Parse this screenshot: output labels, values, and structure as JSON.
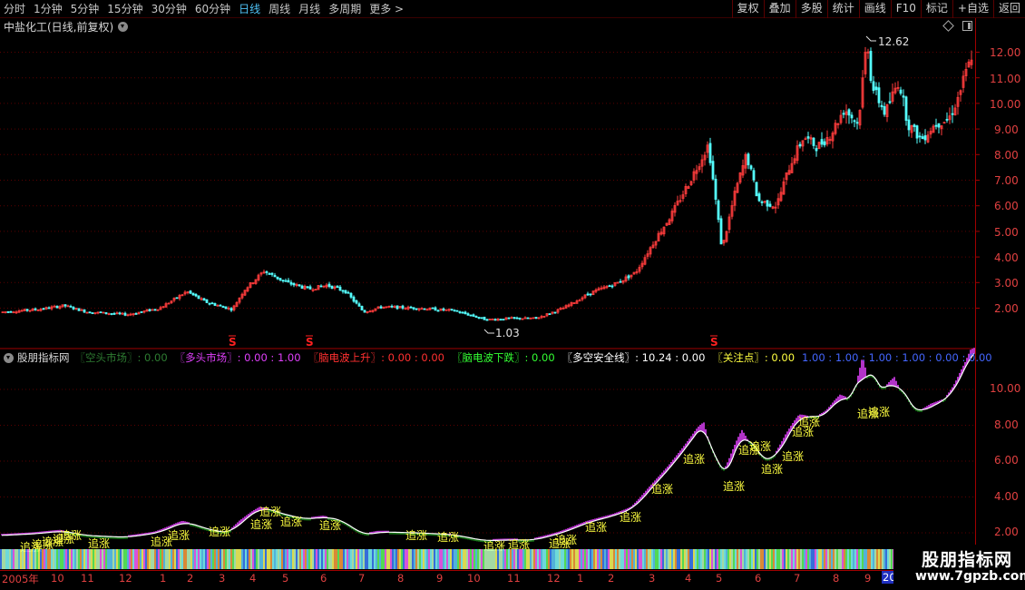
{
  "toolbar": {
    "period_tabs": [
      "分时",
      "1分钟",
      "5分钟",
      "15分钟",
      "30分钟",
      "60分钟",
      "日线",
      "周线",
      "月线",
      "多周期",
      "更多 >"
    ],
    "active_tab": "日线",
    "right_buttons": [
      "复权",
      "叠加",
      "多股",
      "统计",
      "画线",
      "F10",
      "标记",
      "+自选",
      "返回"
    ]
  },
  "main_chart": {
    "title": "中盐化工(日线,前复权)",
    "max_label": "12.62",
    "min_label": "1.03",
    "y_ticks": [
      "12.00",
      "11.00",
      "10.00",
      "9.00",
      "8.00",
      "7.00",
      "6.00",
      "5.00",
      "4.00",
      "3.00",
      "2.00"
    ],
    "markers": [
      "S",
      "S",
      "S"
    ]
  },
  "indicator": {
    "name": "股朋指标网",
    "items": [
      {
        "text": "〖空头市场〗: 0.00",
        "color": "#2e7d32"
      },
      {
        "text": "〖多头市场〗: 0.00 : 1.00",
        "color": "#e040fb"
      },
      {
        "text": "〖脑电波上升〗: 0.00 : 0.00",
        "color": "#ff3030"
      },
      {
        "text": "〖脑电波下跌〗: 0.00",
        "color": "#33ff33"
      },
      {
        "text": "〖多空安全线〗: 10.24 : 0.00",
        "color": "#ffffff"
      },
      {
        "text": "〖关注点〗: 0.00",
        "color": "#ffff40"
      },
      {
        "text": "1.00 : 1.00 : 1.00 : 1.00 : 0.00 : 0.00",
        "color": "#4466ff"
      }
    ],
    "y_ticks": [
      "10.00",
      "8.00",
      "6.00",
      "4.00",
      "2.00"
    ],
    "signal_label": "追涨"
  },
  "x_axis": {
    "labels": [
      "2005年",
      "10",
      "11",
      "12",
      "1",
      "2",
      "3",
      "4",
      "5",
      "6",
      "7",
      "8",
      "9",
      "10",
      "11",
      "12",
      "1",
      "2",
      "3",
      "4",
      "5",
      "6",
      "7",
      "8",
      "9",
      "10"
    ],
    "current_marker": "20"
  },
  "watermark": {
    "title": "股朋指标网",
    "url": "www.7gpzb.com"
  },
  "colors": {
    "up": "#ff3c3c",
    "down": "#54ffff",
    "axis": "#a00000",
    "bull_band": "#e040fb",
    "bear_band": "#1b8a1b"
  }
}
